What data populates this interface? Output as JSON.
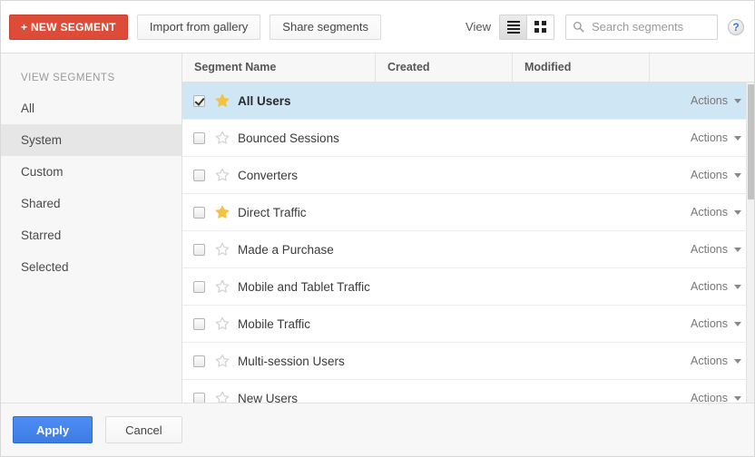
{
  "toolbar": {
    "new_segment_label": "+ NEW SEGMENT",
    "import_label": "Import from gallery",
    "share_label": "Share segments",
    "view_label": "View",
    "list_view_icon": "list-view-icon",
    "grid_view_icon": "grid-view-icon",
    "active_view": "list",
    "search_icon": "search-icon",
    "search_value": "",
    "search_placeholder": "Search segments",
    "help_icon_label": "?"
  },
  "sidebar": {
    "heading": "VIEW SEGMENTS",
    "active": "System",
    "items": [
      {
        "label": "All"
      },
      {
        "label": "System"
      },
      {
        "label": "Custom"
      },
      {
        "label": "Shared"
      },
      {
        "label": "Starred"
      },
      {
        "label": "Selected"
      }
    ]
  },
  "table": {
    "columns": [
      {
        "label": "Segment Name"
      },
      {
        "label": "Created"
      },
      {
        "label": "Modified"
      },
      {
        "label": ""
      }
    ],
    "actions_label": "Actions",
    "rows": [
      {
        "name": "All Users",
        "checked": true,
        "starred": true,
        "created": "",
        "modified": ""
      },
      {
        "name": "Bounced Sessions",
        "checked": false,
        "starred": false,
        "created": "",
        "modified": ""
      },
      {
        "name": "Converters",
        "checked": false,
        "starred": false,
        "created": "",
        "modified": ""
      },
      {
        "name": "Direct Traffic",
        "checked": false,
        "starred": true,
        "created": "",
        "modified": ""
      },
      {
        "name": "Made a Purchase",
        "checked": false,
        "starred": false,
        "created": "",
        "modified": ""
      },
      {
        "name": "Mobile and Tablet Traffic",
        "checked": false,
        "starred": false,
        "created": "",
        "modified": ""
      },
      {
        "name": "Mobile Traffic",
        "checked": false,
        "starred": false,
        "created": "",
        "modified": ""
      },
      {
        "name": "Multi-session Users",
        "checked": false,
        "starred": false,
        "created": "",
        "modified": ""
      },
      {
        "name": "New Users",
        "checked": false,
        "starred": false,
        "created": "",
        "modified": ""
      }
    ]
  },
  "footer": {
    "apply_label": "Apply",
    "cancel_label": "Cancel"
  },
  "colors": {
    "new_segment_red": "#dd4b39",
    "apply_blue": "#4285f4",
    "row_selected_blue": "#cfe6f5",
    "star_gold": "#f5c142",
    "star_empty": "#d4d4d4",
    "sidebar_bg": "#f7f7f7",
    "sidebar_active": "#e6e6e6"
  }
}
